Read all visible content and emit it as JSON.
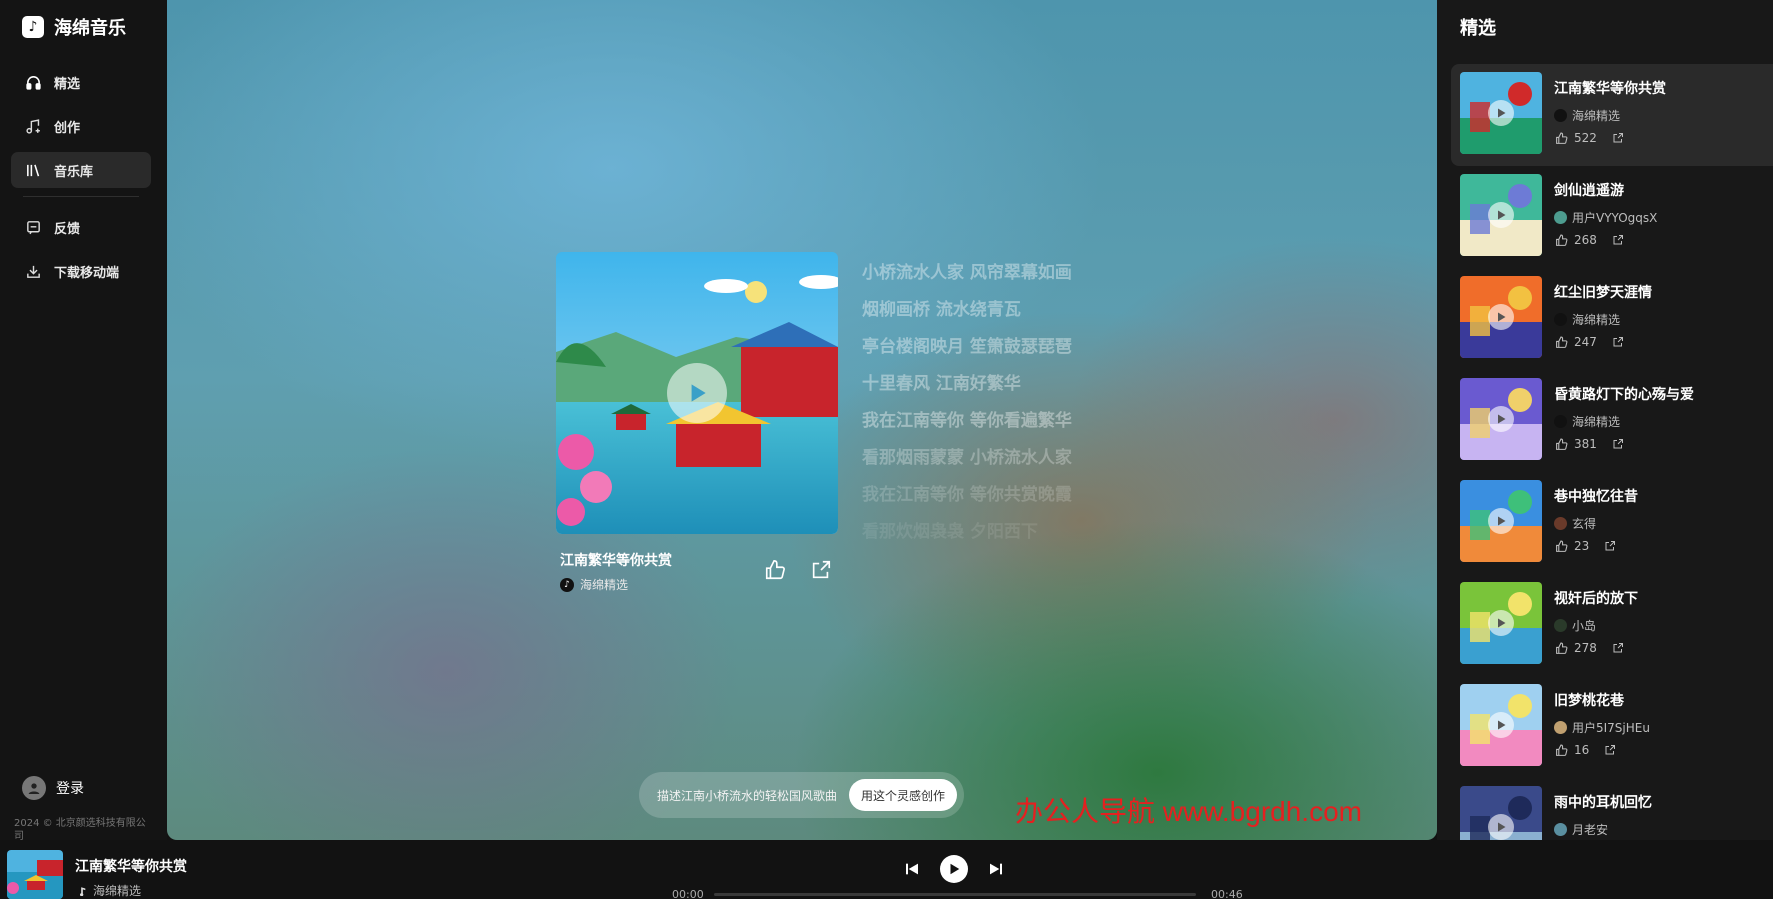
{
  "app": {
    "name": "海绵音乐",
    "logo_glyph": "♪"
  },
  "sidebar": {
    "nav": [
      {
        "label": "精选",
        "icon": "headphones-icon"
      },
      {
        "label": "创作",
        "icon": "music-note-plus-icon"
      },
      {
        "label": "音乐库",
        "icon": "library-icon"
      },
      {
        "label": "反馈",
        "icon": "feedback-icon"
      },
      {
        "label": "下载移动端",
        "icon": "download-icon"
      }
    ],
    "active": "音乐库",
    "login_label": "登录",
    "copyright": "2024 © 北京颜选科技有限公司"
  },
  "stage": {
    "song_title": "江南繁华等你共赏",
    "song_artist": "海绵精选",
    "lyrics": [
      "小桥流水人家 风帘翠幕如画",
      "烟柳画桥 流水绕青瓦",
      "亭台楼阁映月 笙箫鼓瑟琵琶",
      "十里春风 江南好繁华",
      "我在江南等你 等你看遍繁华",
      "看那烟雨蒙蒙 小桥流水人家",
      "我在江南等你 等你共赏晚霞",
      "看那炊烟袅袅 夕阳西下"
    ],
    "prompt_text": "描述江南小桥流水的轻松国风歌曲",
    "prompt_button": "用这个灵感创作",
    "watermark": "办公人导航 www.bgrdh.com"
  },
  "right_panel": {
    "title": "精选",
    "items": [
      {
        "title": "江南繁华等你共赏",
        "author": "海绵精选",
        "likes": "522",
        "author_color": "#111111",
        "thumb_colors": [
          "#4fb3e0",
          "#1f9c6d",
          "#d02a2a"
        ]
      },
      {
        "title": "剑仙逍遥游",
        "author": "用户VYYOgqsX",
        "likes": "268",
        "author_color": "#4d9c8f",
        "thumb_colors": [
          "#3fb89a",
          "#f1e9c7",
          "#6d7bd6"
        ]
      },
      {
        "title": "红尘旧梦天涯情",
        "author": "海绵精选",
        "likes": "247",
        "author_color": "#111111",
        "thumb_colors": [
          "#f06d2a",
          "#3a3a9a",
          "#f2c141"
        ]
      },
      {
        "title": "昏黄路灯下的心殇与爱",
        "author": "海绵精选",
        "likes": "381",
        "author_color": "#111111",
        "thumb_colors": [
          "#6a5ad0",
          "#c7b4f2",
          "#f0d06a"
        ]
      },
      {
        "title": "巷中独忆往昔",
        "author": "玄得",
        "likes": "23",
        "author_color": "#6a3a2a",
        "thumb_colors": [
          "#3a8fe0",
          "#f08a3a",
          "#3ec07a"
        ]
      },
      {
        "title": "视奸后的放下",
        "author": "小岛",
        "likes": "278",
        "author_color": "#2a3a2a",
        "thumb_colors": [
          "#7ac43a",
          "#3aa0d0",
          "#f2e36a"
        ]
      },
      {
        "title": "旧梦桃花巷",
        "author": "用户5I7SjHEu",
        "likes": "16",
        "author_color": "#c0a070",
        "thumb_colors": [
          "#9fd0f0",
          "#f28ac0",
          "#f2e36a"
        ]
      },
      {
        "title": "雨中的耳机回忆",
        "author": "月老安",
        "likes": "",
        "author_color": "#5a8fa0",
        "thumb_colors": [
          "#3a4a8a",
          "#8ab0d0",
          "#1e2a5a"
        ]
      }
    ]
  },
  "player": {
    "title": "江南繁华等你共赏",
    "artist": "海绵精选",
    "current_time": "00:00",
    "total_time": "00:46",
    "progress": 0
  }
}
